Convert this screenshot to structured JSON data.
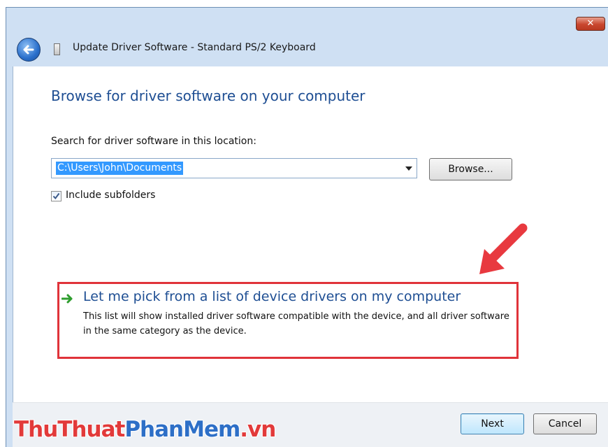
{
  "window": {
    "title": "Update Driver Software - Standard PS/2 Keyboard",
    "close_label": "✕"
  },
  "page": {
    "heading": "Browse for driver software on your computer",
    "search_label": "Search for driver software in this location:",
    "path_value": "C:\\Users\\John\\Documents",
    "browse_label": "Browse...",
    "include_subfolders": {
      "label": "Include subfolders",
      "checked": true
    }
  },
  "option": {
    "title": "Let me pick from a list of device drivers on my computer",
    "description": "This list will show installed driver software compatible with the device, and all driver software in the same category as the device."
  },
  "footer": {
    "next_label": "Next",
    "cancel_label": "Cancel"
  },
  "watermark": {
    "part1": "ThuThuat",
    "part2": "PhanMem",
    "part3": ".vn"
  },
  "colors": {
    "heading": "#1e4e93",
    "highlight_box": "#e0333a",
    "selection": "#3399ff",
    "go_arrow": "#2e9d2e"
  },
  "icons": [
    "back-arrow-icon",
    "driver-device-icon",
    "close-icon",
    "dropdown-arrow-icon",
    "checkmark-icon",
    "green-arrow-icon",
    "red-pointer-arrow-icon"
  ]
}
